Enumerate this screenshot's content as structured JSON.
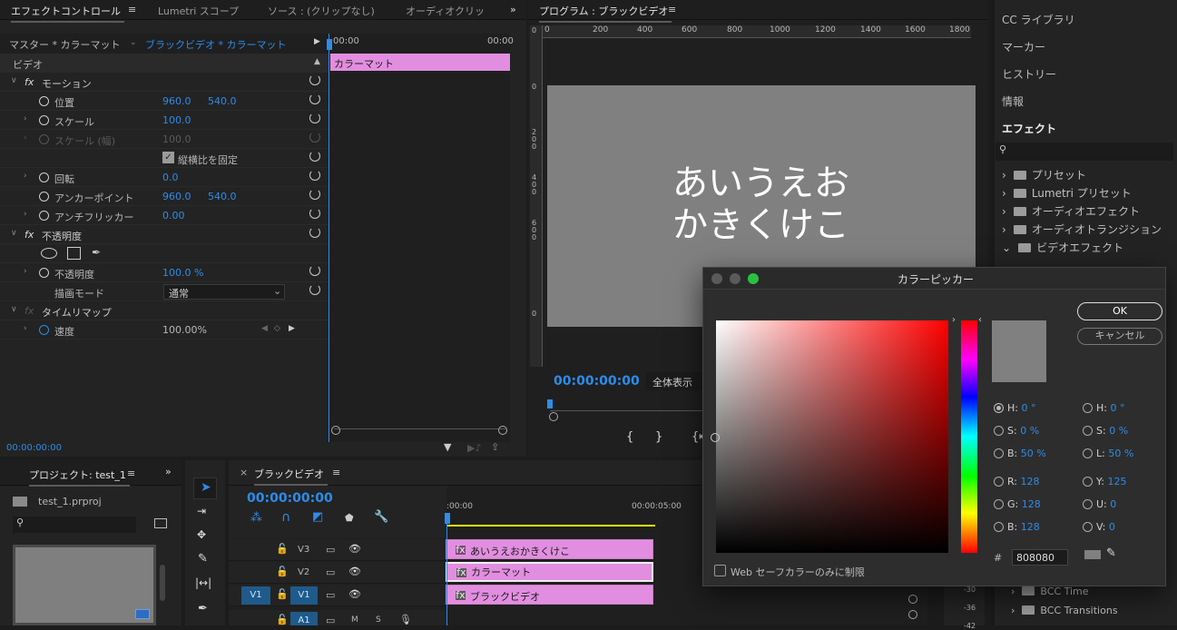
{
  "effect_controls": {
    "tabs": [
      "エフェクトコントロール",
      "Lumetri スコープ",
      "ソース : (クリップなし)",
      "オーディオクリッ"
    ],
    "master_label": "マスター * カラーマット",
    "clip_label": "ブラックビデオ * カラーマット",
    "time_start": "00:00",
    "time_end": "00:00",
    "clip_bar_label": "カラーマット",
    "section_video": "ビデオ",
    "motion": "モーション",
    "position": {
      "label": "位置",
      "x": "960.0",
      "y": "540.0"
    },
    "scale": {
      "label": "スケール",
      "value": "100.0"
    },
    "scale_width": {
      "label": "スケール (幅)",
      "value": "100.0"
    },
    "uniform_scale": "縦横比を固定",
    "rotation": {
      "label": "回転",
      "value": "0.0"
    },
    "anchor": {
      "label": "アンカーポイント",
      "x": "960.0",
      "y": "540.0"
    },
    "flicker": {
      "label": "アンチフリッカー",
      "value": "0.00"
    },
    "opacity_group": "不透明度",
    "opacity": {
      "label": "不透明度",
      "value": "100.0 %"
    },
    "blend": {
      "label": "描画モード",
      "value": "通常"
    },
    "time_remap": "タイムリマップ",
    "speed": {
      "label": "速度",
      "value": "100.00%"
    },
    "timecode": "00:00:00:00"
  },
  "program": {
    "title": "プログラム : ブラックビデオ",
    "ruler": [
      "0",
      "200",
      "400",
      "600",
      "800",
      "1000",
      "1200",
      "1400",
      "1600",
      "1800"
    ],
    "vruler": [
      "0",
      "2 0 0",
      "4 0 0",
      "6 0 0"
    ],
    "text_line1": "あいうえお",
    "text_line2": "かきくけこ",
    "timecode": "00:00:00:00",
    "fit": "全体表示"
  },
  "project": {
    "title": "プロジェクト: test_1",
    "file": "test_1.prproj"
  },
  "timeline": {
    "title": "ブラックビデオ",
    "timecode": "00:00:00:00",
    "ruler_start": ":00:00",
    "ruler_mid": "00:00:05:00",
    "tracks": [
      "V3",
      "V2",
      "V1",
      "A1"
    ],
    "source_patch": "V1",
    "clips": [
      "あいうえおかきくけこ",
      "カラーマット",
      "ブラックビデオ"
    ],
    "track_m": "M",
    "track_s": "S"
  },
  "right_panel": {
    "items": [
      "CC ライブラリ",
      "マーカー",
      "ヒストリー",
      "情報",
      "エフェクト"
    ],
    "tree": [
      "プリセット",
      "Lumetri プリセット",
      "オーディオエフェクト",
      "オーディオトランジション",
      "ビデオエフェクト"
    ],
    "tree_bottom": [
      "BCC Time",
      "BCC Transitions"
    ],
    "meter": [
      "-30",
      "-36",
      "-42"
    ]
  },
  "color_picker": {
    "title": "カラーピッカー",
    "ok": "OK",
    "cancel": "キャンセル",
    "h": {
      "label": "H:",
      "value": "0 °"
    },
    "s": {
      "label": "S:",
      "value": "0 %"
    },
    "b": {
      "label": "B:",
      "value": "50 %"
    },
    "r": {
      "label": "R:",
      "value": "128"
    },
    "g": {
      "label": "G:",
      "value": "128"
    },
    "b2": {
      "label": "B:",
      "value": "128"
    },
    "h2": {
      "label": "H:",
      "value": "0 °"
    },
    "s2": {
      "label": "S:",
      "value": "0 %"
    },
    "l": {
      "label": "L:",
      "value": "50 %"
    },
    "y": {
      "label": "Y:",
      "value": "125"
    },
    "u": {
      "label": "U:",
      "value": "0"
    },
    "v": {
      "label": "V:",
      "value": "0"
    },
    "hex_label": "#",
    "hex": "808080",
    "web_safe": "Web セーフカラーのみに制限",
    "swatch_color": "#808080"
  }
}
